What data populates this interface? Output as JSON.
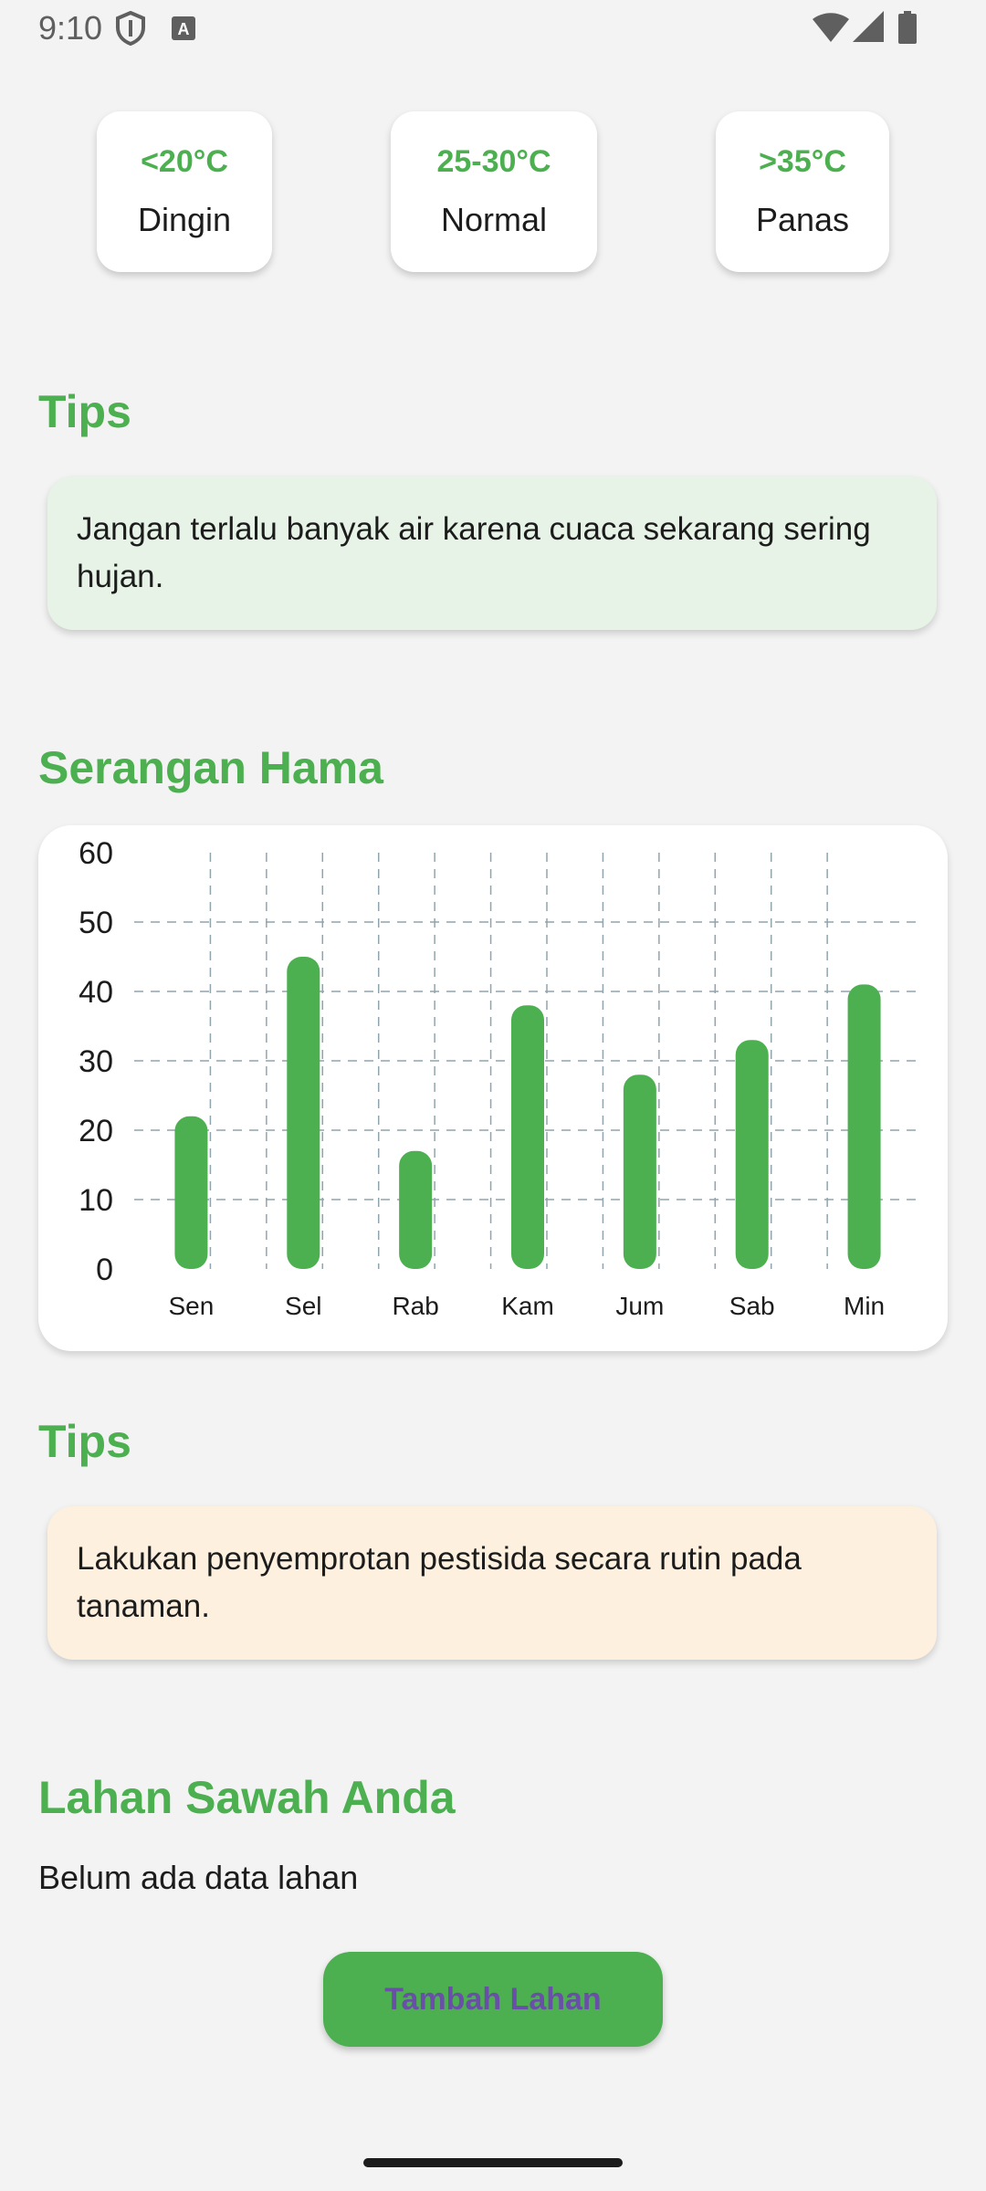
{
  "status_bar": {
    "time": "9:10",
    "icons_left": [
      "shield-icon",
      "keyboard-a-icon"
    ],
    "icons_right": [
      "wifi-icon",
      "signal-icon",
      "battery-icon"
    ]
  },
  "temperature_cards": [
    {
      "range": "<20°C",
      "label": "Dingin"
    },
    {
      "range": "25-30°C",
      "label": "Normal"
    },
    {
      "range": ">35°C",
      "label": "Panas"
    }
  ],
  "tips_weather": {
    "title": "Tips",
    "text": "Jangan terlalu banyak air karena cuaca sekarang sering hujan.",
    "background": "#e6f3e6"
  },
  "pest_section": {
    "title": "Serangan Hama"
  },
  "chart_data": {
    "type": "bar",
    "categories": [
      "Sen",
      "Sel",
      "Rab",
      "Kam",
      "Jum",
      "Sab",
      "Min"
    ],
    "values": [
      22,
      45,
      17,
      38,
      28,
      33,
      41
    ],
    "ylim": [
      0,
      60
    ],
    "yticks": [
      0,
      10,
      20,
      30,
      40,
      50,
      60
    ],
    "grid": true,
    "bar_color": "#4caf50",
    "grid_color": "#90a4ae"
  },
  "tips_pest": {
    "title": "Tips",
    "text": "Lakukan penyemprotan pestisida secara rutin pada tanaman.",
    "background": "#fdf0de"
  },
  "land_section": {
    "title": "Lahan Sawah Anda",
    "empty_text": "Belum ada data lahan",
    "add_button_label": "Tambah Lahan"
  },
  "colors": {
    "accent": "#4caf50",
    "button_text": "#6a4fa8",
    "background": "#f3f3f3"
  }
}
